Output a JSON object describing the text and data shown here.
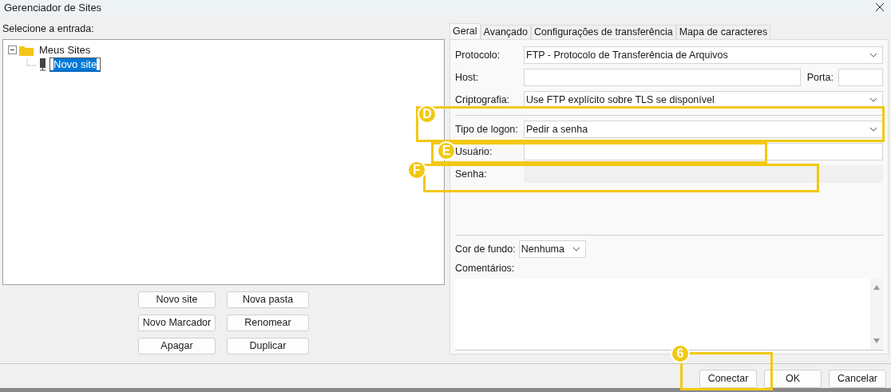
{
  "window": {
    "title": "Gerenciador de Sites"
  },
  "entry_label": "Selecione a entrada:",
  "tree": [
    {
      "label": "Meus Sites",
      "kind": "folder",
      "expanded": true,
      "children": [
        {
          "label": "Novo site",
          "kind": "site",
          "selected": true
        }
      ]
    }
  ],
  "tree_buttons": [
    "Novo site",
    "Nova pasta",
    "Novo Marcador",
    "Renomear",
    "Apagar",
    "Duplicar"
  ],
  "tabs": [
    {
      "label": "Geral",
      "selected": true
    },
    {
      "label": "Avançado",
      "selected": false
    },
    {
      "label": "Configurações de transferência",
      "selected": false
    },
    {
      "label": "Mapa de caracteres",
      "selected": false
    }
  ],
  "form": [
    {
      "kind": "select",
      "label": "Protocolo:",
      "value": "FTP - Protocolo de Transferência de Arquivos"
    },
    {
      "kind": "host",
      "label": "Host:",
      "port_label": "Porta:"
    },
    {
      "kind": "select",
      "label": "Criptografia:",
      "value": "Use FTP explícito sobre TLS se disponível"
    },
    {
      "kind": "divider"
    },
    {
      "kind": "select",
      "label": "Tipo de logon:",
      "value": "Pedir a senha"
    },
    {
      "kind": "input",
      "label": "Usuário:",
      "disabled": false
    },
    {
      "kind": "input",
      "label": "Senha:",
      "disabled": true
    }
  ],
  "background_color": {
    "label": "Cor de fundo:",
    "value": "Nenhuma"
  },
  "comments_label": "Comentários:",
  "footer_buttons": [
    "Conectar",
    "OK",
    "Cancelar"
  ],
  "callouts": [
    {
      "label": "D"
    },
    {
      "label": "E"
    },
    {
      "label": "F"
    },
    {
      "label": "6"
    }
  ]
}
